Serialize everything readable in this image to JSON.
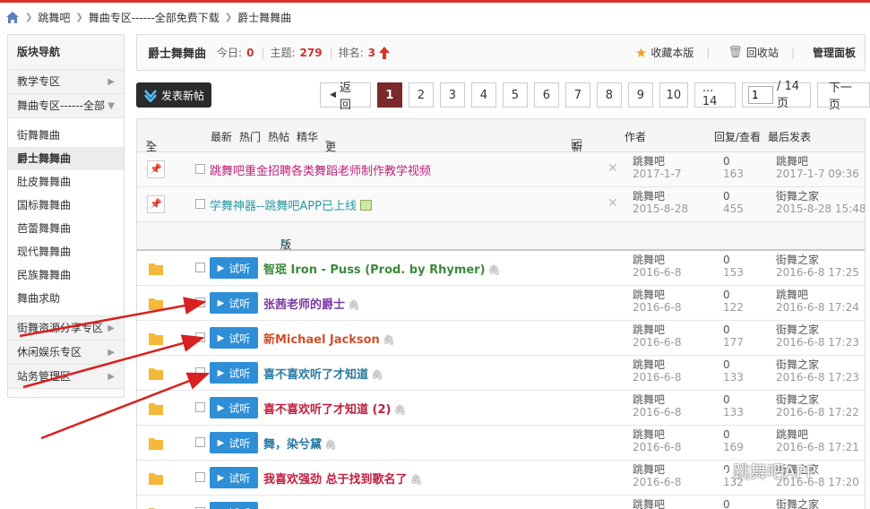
{
  "breadcrumb": [
    "跳舞吧",
    "舞曲专区------全部免费下载",
    "爵士舞舞曲"
  ],
  "sidebar": {
    "title": "版块导航",
    "groups": [
      {
        "label": "教学专区"
      },
      {
        "label": "舞曲专区------全部"
      },
      {
        "label": "街舞资源分享专区"
      },
      {
        "label": "休闲娱乐专区"
      },
      {
        "label": "站务管理区"
      }
    ],
    "subs": [
      "街舞舞曲",
      "爵士舞舞曲",
      "肚皮舞舞曲",
      "国标舞舞曲",
      "芭蕾舞舞曲",
      "现代舞舞曲",
      "民族舞舞曲",
      "舞曲求助"
    ]
  },
  "header": {
    "forum_name": "爵士舞舞曲",
    "today_label": "今日:",
    "today_value": "0",
    "topics_label": "主题:",
    "topics_value": "279",
    "rank_label": "排名:",
    "rank_value": "3",
    "favorite": "收藏本版",
    "recycle": "回收站",
    "admin": "管理面板"
  },
  "toolbar": {
    "post_label": "发表新帖",
    "back_label": "返 回",
    "pages": [
      "1",
      "2",
      "3",
      "4",
      "5",
      "6",
      "7",
      "8",
      "9",
      "10"
    ],
    "ellipsis_label": "... 14",
    "page_input": "1",
    "page_total": "/ 14 页",
    "next_label": "下一页"
  },
  "table_header": {
    "all": "全部主题",
    "latest": "最新",
    "hot": "热门",
    "hotposts": "热帖",
    "digest": "精华",
    "more": "更多",
    "newwin": "新窗",
    "author": "作者",
    "replies": "回复/查看",
    "lastpost": "最后发表"
  },
  "section_label": "版块主题",
  "play_label": "试听",
  "sticky": [
    {
      "title": "跳舞吧重金招聘各类舞蹈老师制作教学视频",
      "color": "#c0207a",
      "author": "跳舞吧",
      "date": "2017-1-7",
      "replies": "0",
      "views": "163",
      "last_user": "跳舞吧",
      "last_time": "2017-1-7 09:36"
    },
    {
      "title": "学舞神器--跳舞吧APP已上线",
      "color": "#2a9aa6",
      "author": "跳舞吧",
      "date": "2015-8-28",
      "replies": "0",
      "views": "455",
      "last_user": "街舞之家",
      "last_time": "2015-8-28 15:48"
    }
  ],
  "threads": [
    {
      "title": "智珉 Iron - Puss (Prod. by Rhymer)",
      "color": "#3a8a3a",
      "author": "跳舞吧",
      "date": "2016-6-8",
      "replies": "0",
      "views": "153",
      "last_user": "街舞之家",
      "last_time": "2016-6-8 17:25"
    },
    {
      "title": "张茜老师的爵士",
      "color": "#7a3aa0",
      "author": "跳舞吧",
      "date": "2016-6-8",
      "replies": "0",
      "views": "122",
      "last_user": "跳舞吧",
      "last_time": "2016-6-8 17:24"
    },
    {
      "title": "新Michael Jackson",
      "color": "#d0502a",
      "author": "跳舞吧",
      "date": "2016-6-8",
      "replies": "0",
      "views": "177",
      "last_user": "街舞之家",
      "last_time": "2016-6-8 17:23"
    },
    {
      "title": "喜不喜欢听了才知道",
      "color": "#2a7aa0",
      "author": "跳舞吧",
      "date": "2016-6-8",
      "replies": "0",
      "views": "133",
      "last_user": "街舞之家",
      "last_time": "2016-6-8 17:23"
    },
    {
      "title": "喜不喜欢听了才知道 (2)",
      "color": "#c02040",
      "author": "跳舞吧",
      "date": "2016-6-8",
      "replies": "0",
      "views": "133",
      "last_user": "街舞之家",
      "last_time": "2016-6-8 17:22"
    },
    {
      "title": "舞，染兮黛",
      "color": "#2a7aa0",
      "author": "跳舞吧",
      "date": "2016-6-8",
      "replies": "0",
      "views": "169",
      "last_user": "跳舞吧",
      "last_time": "2016-6-8 17:21"
    },
    {
      "title": "我喜欢强劲 总于找到歌名了",
      "color": "#c02040",
      "author": "跳舞吧",
      "date": "2016-6-8",
      "replies": "0",
      "views": "132",
      "last_user": "街舞之家",
      "last_time": "2016-6-8 17:20"
    },
    {
      "title": "",
      "color": "#333333",
      "author": "跳舞吧",
      "date": "",
      "replies": "0",
      "views": "",
      "last_user": "街舞之家",
      "last_time": ""
    }
  ],
  "watermark": "跳舞吧APP",
  "colors": {
    "accent_red": "#d9342a",
    "play_blue": "#2e8fd6",
    "page_active": "#7a2a2a"
  }
}
